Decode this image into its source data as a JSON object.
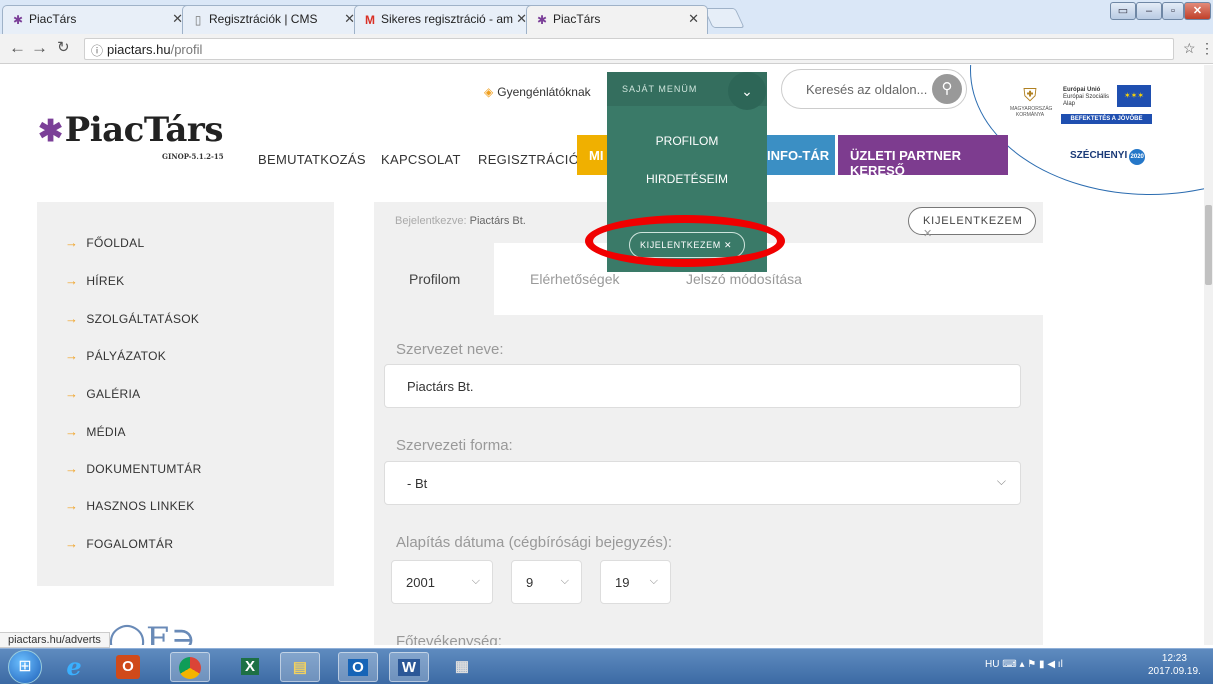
{
  "browser": {
    "tabs": [
      {
        "title": "PiacTárs",
        "icon": "piactars-favicon"
      },
      {
        "title": "Regisztrációk | CMS",
        "icon": "page-icon"
      },
      {
        "title": "Sikeres regisztráció - am",
        "icon": "gmail-icon"
      },
      {
        "title": "PiacTárs",
        "icon": "piactars-favicon"
      }
    ],
    "url_host": "piactars.hu",
    "url_path": "/profil",
    "status_url": "piactars.hu/adverts"
  },
  "header": {
    "logo_text": "PiacTárs",
    "logo_sub": "GINOP-5.1.2-15",
    "accessibility": "Gyengénlátóknak",
    "search_placeholder": "Keresés az oldalon...",
    "nav": [
      "BEMUTATKOZÁS",
      "KAPCSOLAT",
      "REGISZTRÁCIÓ",
      "MI",
      "INFO-TÁR",
      "ÜZLETI PARTNER KERESŐ"
    ],
    "eu": {
      "line1": "Európai Unió",
      "line2": "Európai Szociális",
      "line3": "Alap",
      "gov1": "MAGYARORSZÁG",
      "gov2": "KORMÁNYA",
      "slogan": "BEFEKTETÉS A JÖVŐBE",
      "szechenyi": "SZÉCHENYI",
      "year": "2020"
    }
  },
  "menu": {
    "title": "SAJÁT MENÜM",
    "items": [
      "PROFILOM",
      "HIRDETÉSEIM"
    ],
    "logout": "KIJELENTKEZEM"
  },
  "sidebar": {
    "items": [
      "FŐOLDAL",
      "HÍREK",
      "SZOLGÁLTATÁSOK",
      "PÁLYÁZATOK",
      "GALÉRIA",
      "MÉDIA",
      "DOKUMENTUMTÁR",
      "HASZNOS LINKEK",
      "FOGALOMTÁR"
    ]
  },
  "main": {
    "logged_in_label": "Bejelentkezve:",
    "logged_in_user": "Piactárs Bt.",
    "logout": "KIJELENTKEZEM",
    "tabs": [
      "Profilom",
      "Elérhetőségek",
      "Jelszó módosítása"
    ],
    "fields": {
      "org_name_label": "Szervezet neve:",
      "org_name_value": "Piactárs Bt.",
      "org_form_label": "Szervezeti forma:",
      "org_form_value": "- Bt",
      "founding_label": "Alapítás dátuma (cégbírósági bejegyzés):",
      "year": "2001",
      "month": "9",
      "day": "19",
      "activity_label": "Főtevékenység:"
    }
  },
  "taskbar": {
    "lang": "HU",
    "time": "12:23",
    "date": "2017.09.19."
  },
  "colors": {
    "menu_green": "#3a7a68",
    "accent_orange": "#f0a020",
    "info_blue": "#3b8fc4",
    "partner_purple": "#7d3c8f",
    "highlight_red": "#f00000"
  }
}
